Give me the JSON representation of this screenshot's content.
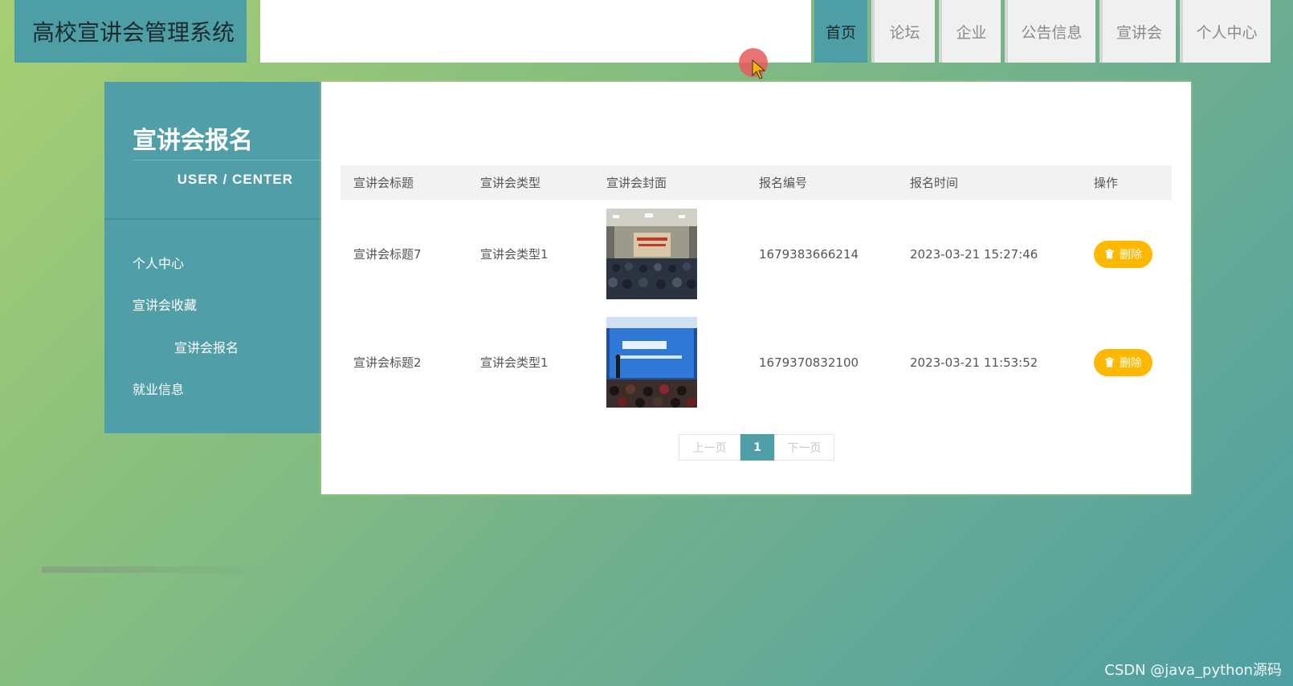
{
  "app_title": "高校宣讲会管理系统",
  "nav": [
    "首页",
    "论坛",
    "企业",
    "公告信息",
    "宣讲会",
    "个人中心"
  ],
  "sidebar": {
    "title": "宣讲会报名",
    "subtitle": "USER / CENTER",
    "items": [
      "个人中心",
      "宣讲会收藏",
      "宣讲会报名",
      "就业信息"
    ]
  },
  "table": {
    "headers": [
      "宣讲会标题",
      "宣讲会类型",
      "宣讲会封面",
      "报名编号",
      "报名时间",
      "操作"
    ],
    "rows": [
      {
        "title": "宣讲会标题7",
        "type": "宣讲会类型1",
        "cover": "lecture-hall-photo",
        "number": "1679383666214",
        "time": "2023-03-21 15:27:46",
        "action": "删除"
      },
      {
        "title": "宣讲会标题2",
        "type": "宣讲会类型1",
        "cover": "presentation-stage-photo",
        "number": "1679370832100",
        "time": "2023-03-21 11:53:52",
        "action": "删除"
      }
    ]
  },
  "pagination": {
    "prev": "上一页",
    "current": "1",
    "next": "下一页"
  },
  "watermark": "CSDN @java_python源码",
  "colors": {
    "primary": "#509ea7",
    "delete_button": "#ffb800"
  }
}
